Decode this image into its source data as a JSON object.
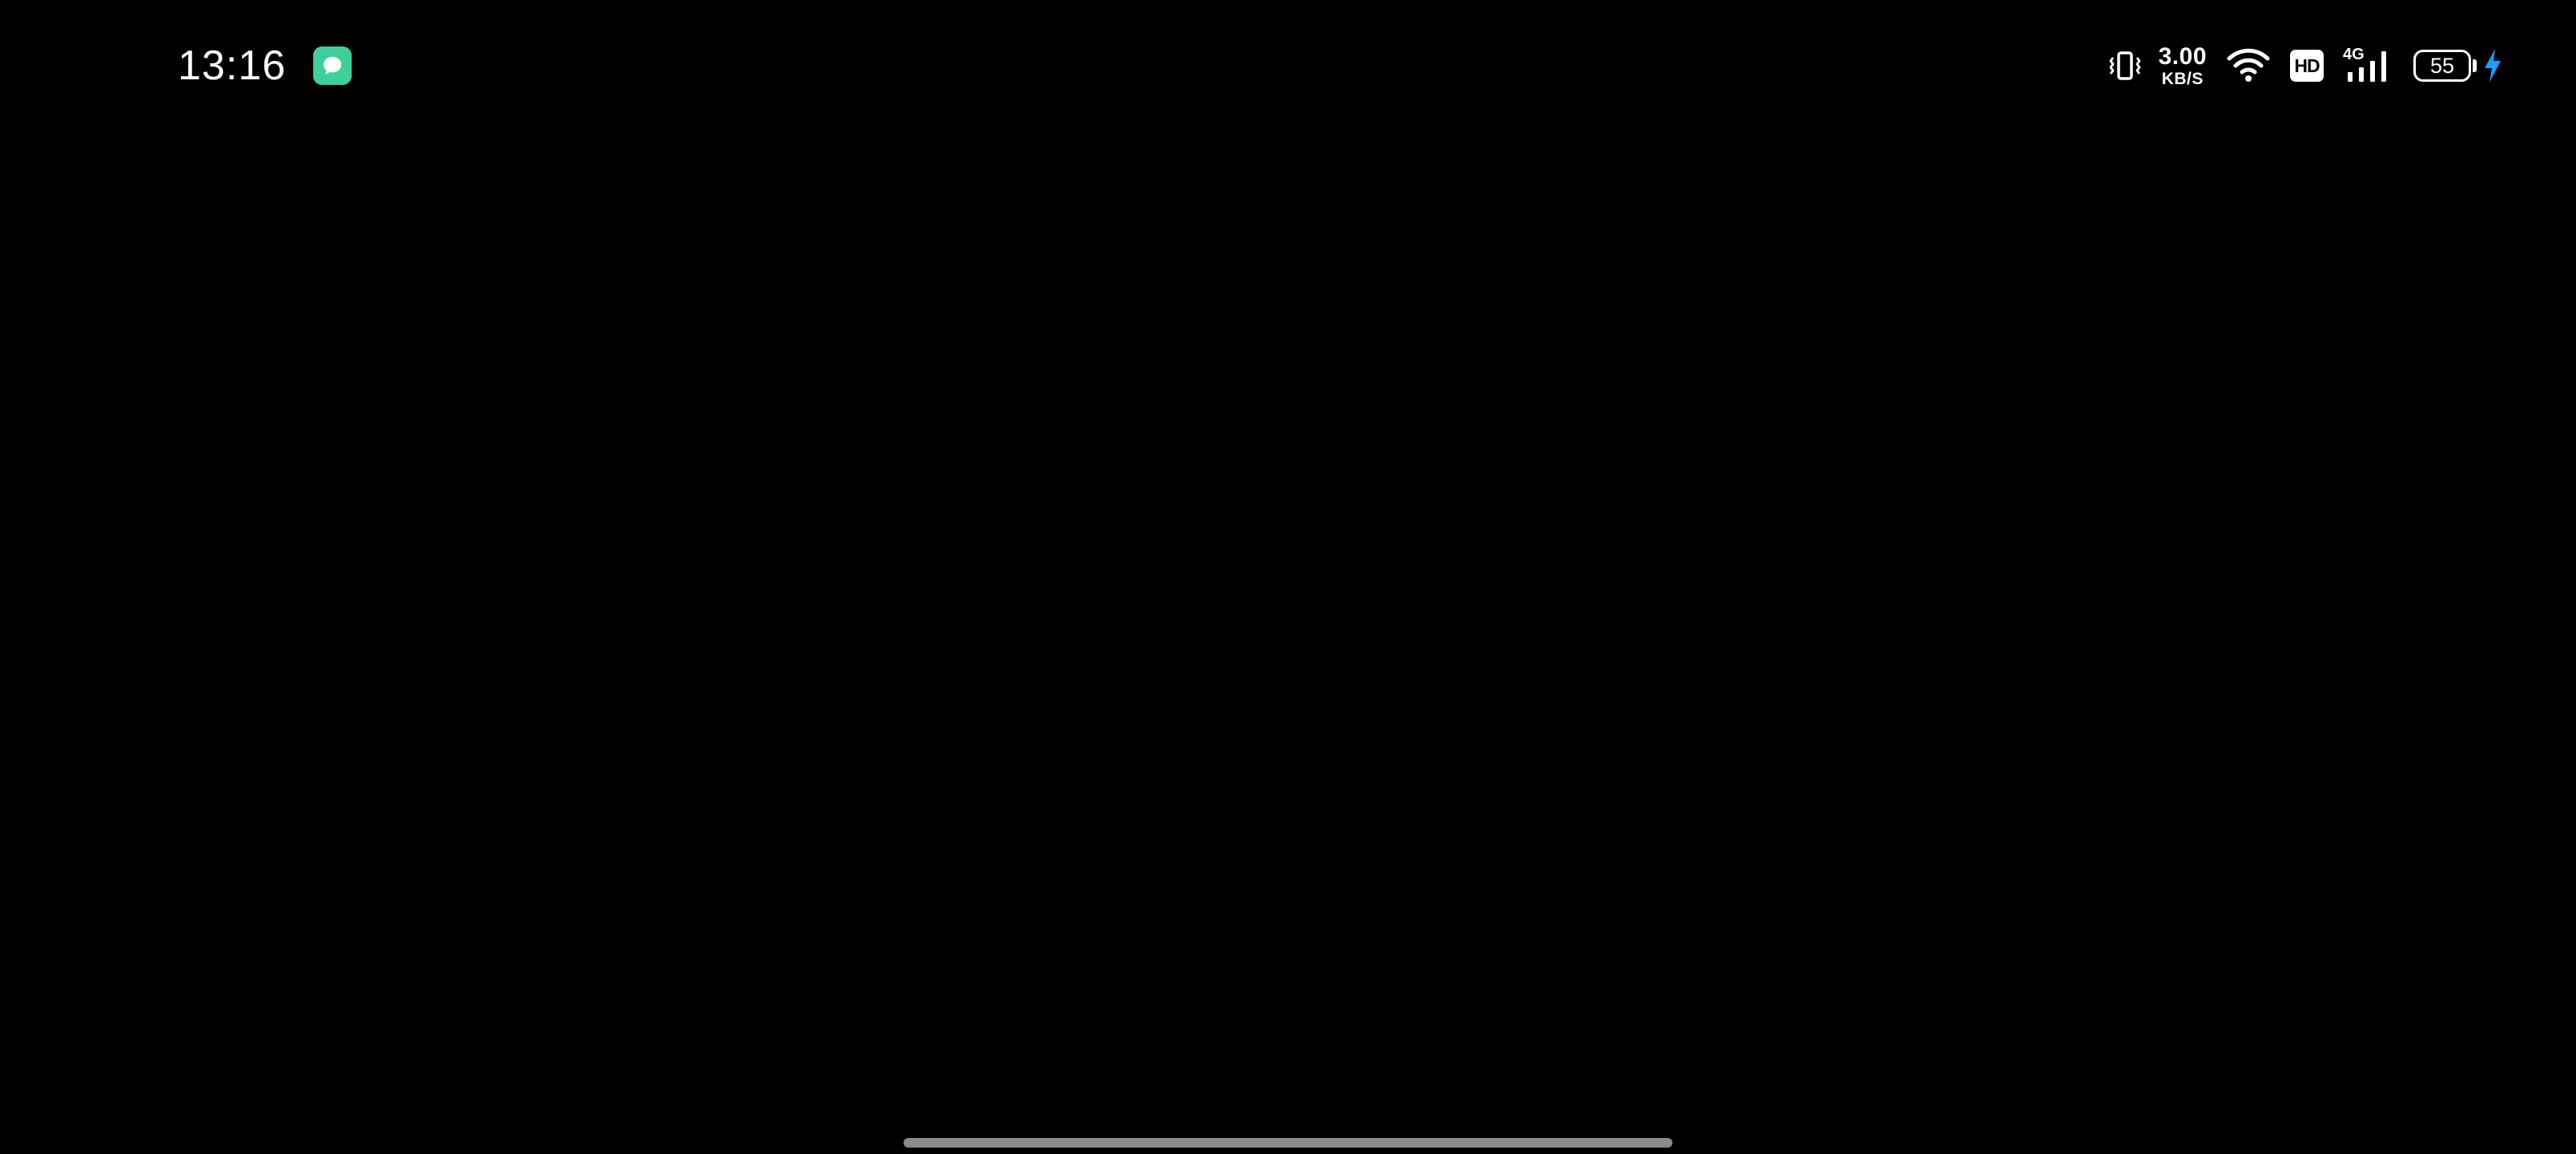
{
  "status_bar": {
    "time": "13:16",
    "notification_app_icon": "chat-bubble-icon",
    "notification_app_color": "#3ecf9a",
    "network_speed_value": "3.00",
    "network_speed_unit": "KB/S",
    "vibrate_icon": "vibrate-icon",
    "wifi_icon": "wifi-icon",
    "hd_label": "HD",
    "network_generation": "4G",
    "battery_level": "55",
    "charging_icon": "charging-bolt-icon",
    "charging_color": "#1e9bff"
  },
  "home_indicator": {
    "color": "#8a8a8a"
  },
  "background_color": "#000000"
}
